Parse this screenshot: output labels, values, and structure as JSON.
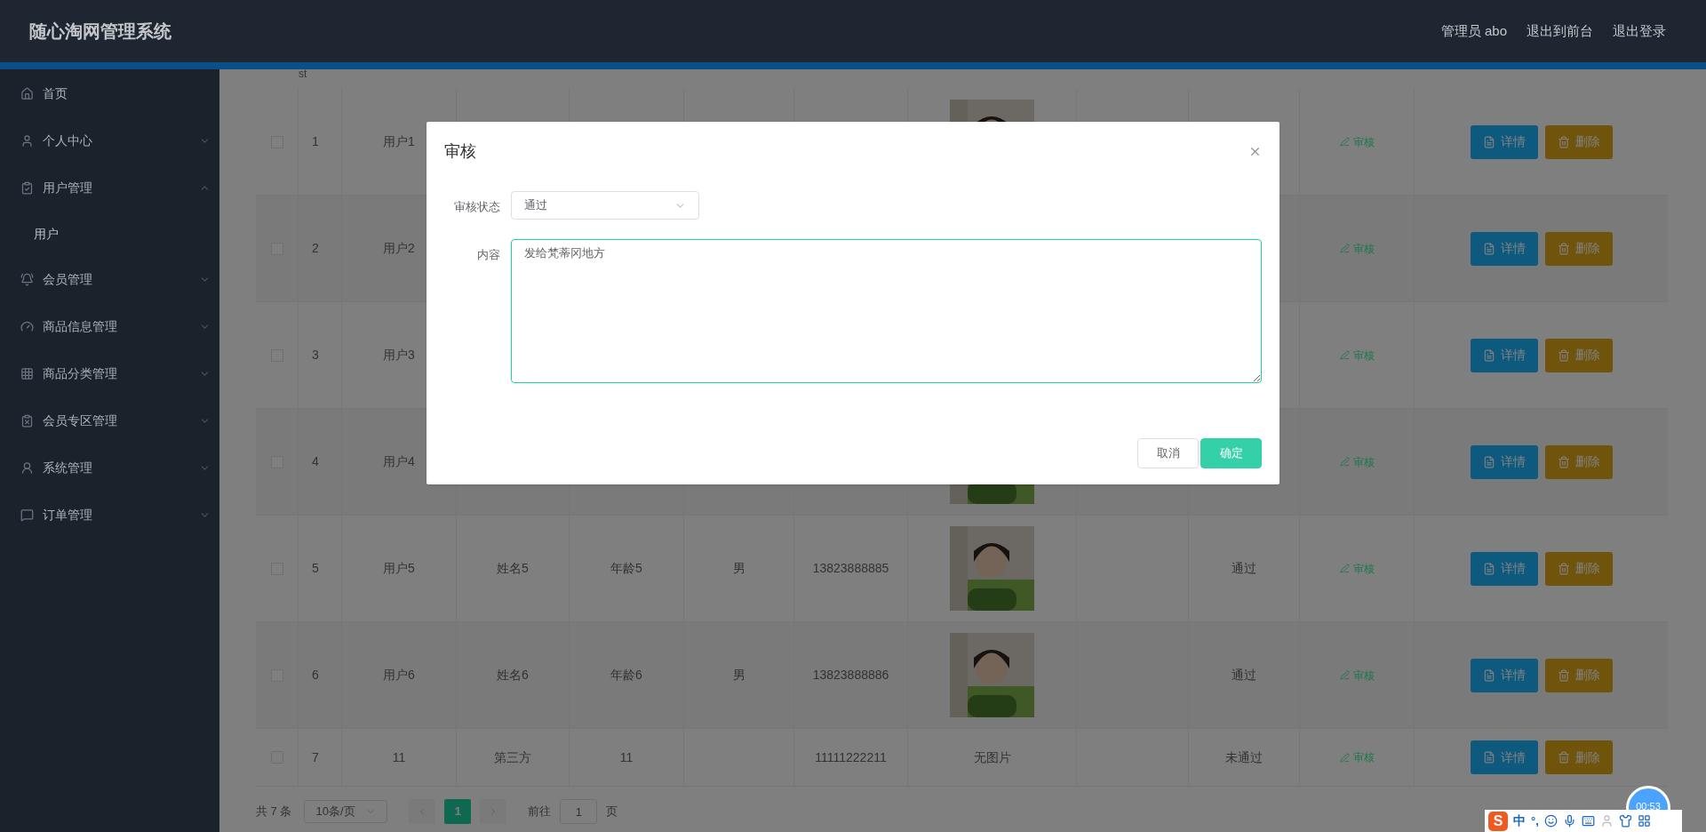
{
  "header": {
    "title": "随心淘网管理系统",
    "links": [
      "管理员 abo",
      "退出到前台",
      "退出登录"
    ]
  },
  "sidebar": {
    "items": [
      {
        "label": "首页"
      },
      {
        "label": "个人中心",
        "expanded": false
      },
      {
        "label": "用户管理",
        "expanded": true,
        "children": [
          {
            "label": "用户"
          }
        ]
      },
      {
        "label": "会员管理",
        "expanded": false
      },
      {
        "label": "商品信息管理",
        "expanded": false
      },
      {
        "label": "商品分类管理",
        "expanded": false
      },
      {
        "label": "会员专区管理",
        "expanded": false
      },
      {
        "label": "系统管理",
        "expanded": false
      },
      {
        "label": "订单管理",
        "expanded": false
      }
    ]
  },
  "table": {
    "header_fragment": "st",
    "rows": [
      {
        "checked": false,
        "index": "1",
        "username": "用户1",
        "photo": {
          "kind": "picture"
        },
        "review": "审核",
        "actions": [
          "详情",
          "删除"
        ]
      },
      {
        "checked": false,
        "index": "2",
        "username": "用户2",
        "review": "审核",
        "actions": [
          "详情",
          "删除"
        ]
      },
      {
        "checked": false,
        "index": "3",
        "username": "用户3",
        "review": "审核",
        "actions": [
          "详情",
          "删除"
        ]
      },
      {
        "checked": false,
        "index": "4",
        "username": "用户4",
        "photo": {
          "kind": "picture"
        },
        "review": "审核",
        "actions": [
          "详情",
          "删除"
        ]
      },
      {
        "checked": false,
        "index": "5",
        "username": "用户5",
        "name": "姓名5",
        "age": "年龄5",
        "gender": "男",
        "phone": "13823888885",
        "photo": {
          "kind": "picture"
        },
        "status": "通过",
        "review": "审核",
        "actions": [
          "详情",
          "删除"
        ]
      },
      {
        "checked": false,
        "index": "6",
        "username": "用户6",
        "name": "姓名6",
        "age": "年龄6",
        "gender": "男",
        "phone": "13823888886",
        "photo": {
          "kind": "picture"
        },
        "status": "通过",
        "review": "审核",
        "actions": [
          "详情",
          "删除"
        ]
      },
      {
        "checked": false,
        "index": "7",
        "username": "11",
        "name": "第三方",
        "age": "11",
        "phone": "11111222211",
        "photo_text": "无图片",
        "status": "未通过",
        "review": "审核",
        "actions": [
          "详情",
          "删除"
        ]
      }
    ]
  },
  "pagination": {
    "total": "共 7 条",
    "page_size": "10条/页",
    "pages": [
      {
        "label": "1",
        "selected": true
      }
    ],
    "goto_label": "前往",
    "goto_value": "1",
    "goto_suffix": "页"
  },
  "dialog": {
    "title": "审核",
    "fields": [
      {
        "kind": "select",
        "label": "审核状态",
        "value": "通过"
      },
      {
        "kind": "textarea",
        "label": "内容",
        "value": "发给梵蒂冈地方"
      }
    ],
    "buttons": [
      {
        "label": "取消",
        "kind": "default"
      },
      {
        "label": "确定",
        "kind": "primary"
      }
    ]
  },
  "ime": {
    "logo": "S",
    "mode": "中",
    "punct": "°,"
  },
  "timer": "00:53"
}
